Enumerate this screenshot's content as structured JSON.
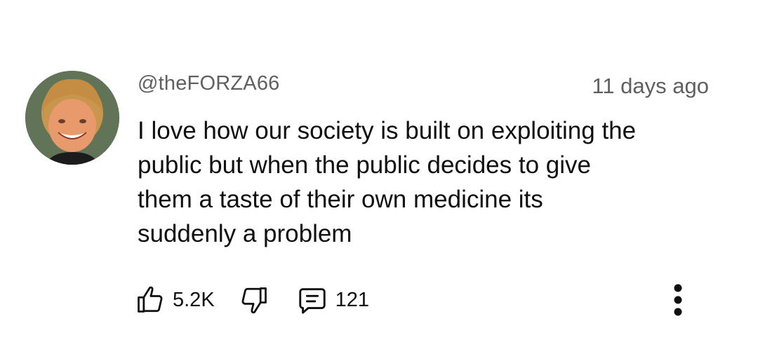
{
  "comment": {
    "author": "@theFORZA66",
    "timestamp": "11 days ago",
    "text_lines": [
      "I love how our society is built on exploiting the",
      "public but when the public decides to give",
      "them a taste of their own medicine its",
      "suddenly a problem"
    ],
    "avatar_icon": "user-avatar-photo",
    "actions": {
      "like_icon": "thumbs-up-icon",
      "like_count": "5.2K",
      "dislike_icon": "thumbs-down-icon",
      "reply_icon": "comment-bubble-icon",
      "reply_count": "121",
      "more_icon": "vertical-ellipsis-icon"
    }
  },
  "colors": {
    "text_primary": "#0f0f0f",
    "text_secondary": "#606060",
    "background": "#ffffff"
  }
}
